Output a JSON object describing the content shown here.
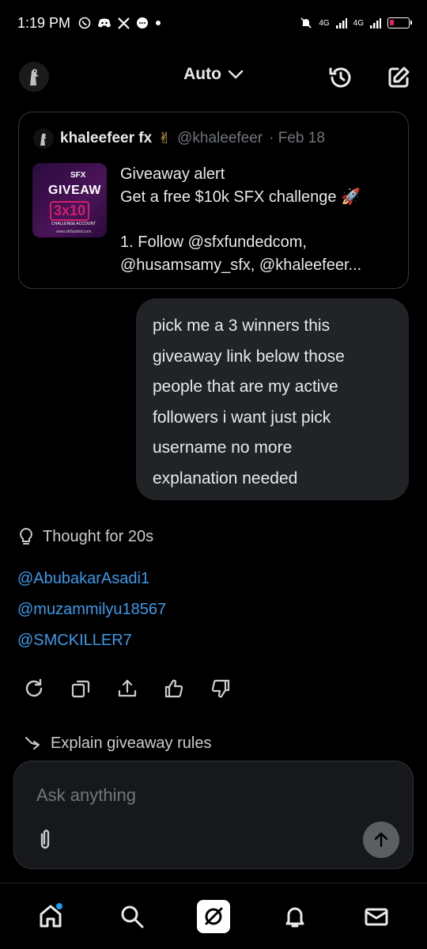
{
  "status": {
    "time": "1:19 PM",
    "net1": "4G",
    "net2": "4G"
  },
  "header": {
    "model": "Auto"
  },
  "quote": {
    "name": "khaleefeer fx",
    "emoji": "✌",
    "handle": "@khaleefeer",
    "date": "· Feb 18",
    "thumb": {
      "brand": "SFX",
      "title": "GIVEAW",
      "badge": "3x10",
      "sub": "CHALLENGE ACCOUNT",
      "url": "www.sfxfunded.com"
    },
    "line1": "Giveaway alert",
    "line2": "Get a free $10k SFX challenge 🚀",
    "line3": "1. Follow @sfxfundedcom,",
    "line4": "@husamsamy_sfx, @khaleefeer..."
  },
  "user_message": {
    "lines": [
      "pick me a 3 winners  this",
      "giveaway link below those",
      "people that are my active",
      "followers i want just pick",
      "username no more",
      "explanation needed"
    ]
  },
  "thought": "Thought for 20s",
  "winners": [
    "@AbubakarAsadi1",
    "@muzammilyu18567",
    "@SMCKILLER7"
  ],
  "suggestion": "Explain giveaway rules",
  "composer": {
    "placeholder": "Ask anything"
  },
  "nav": [
    "home",
    "search",
    "grok",
    "notifications",
    "messages"
  ]
}
